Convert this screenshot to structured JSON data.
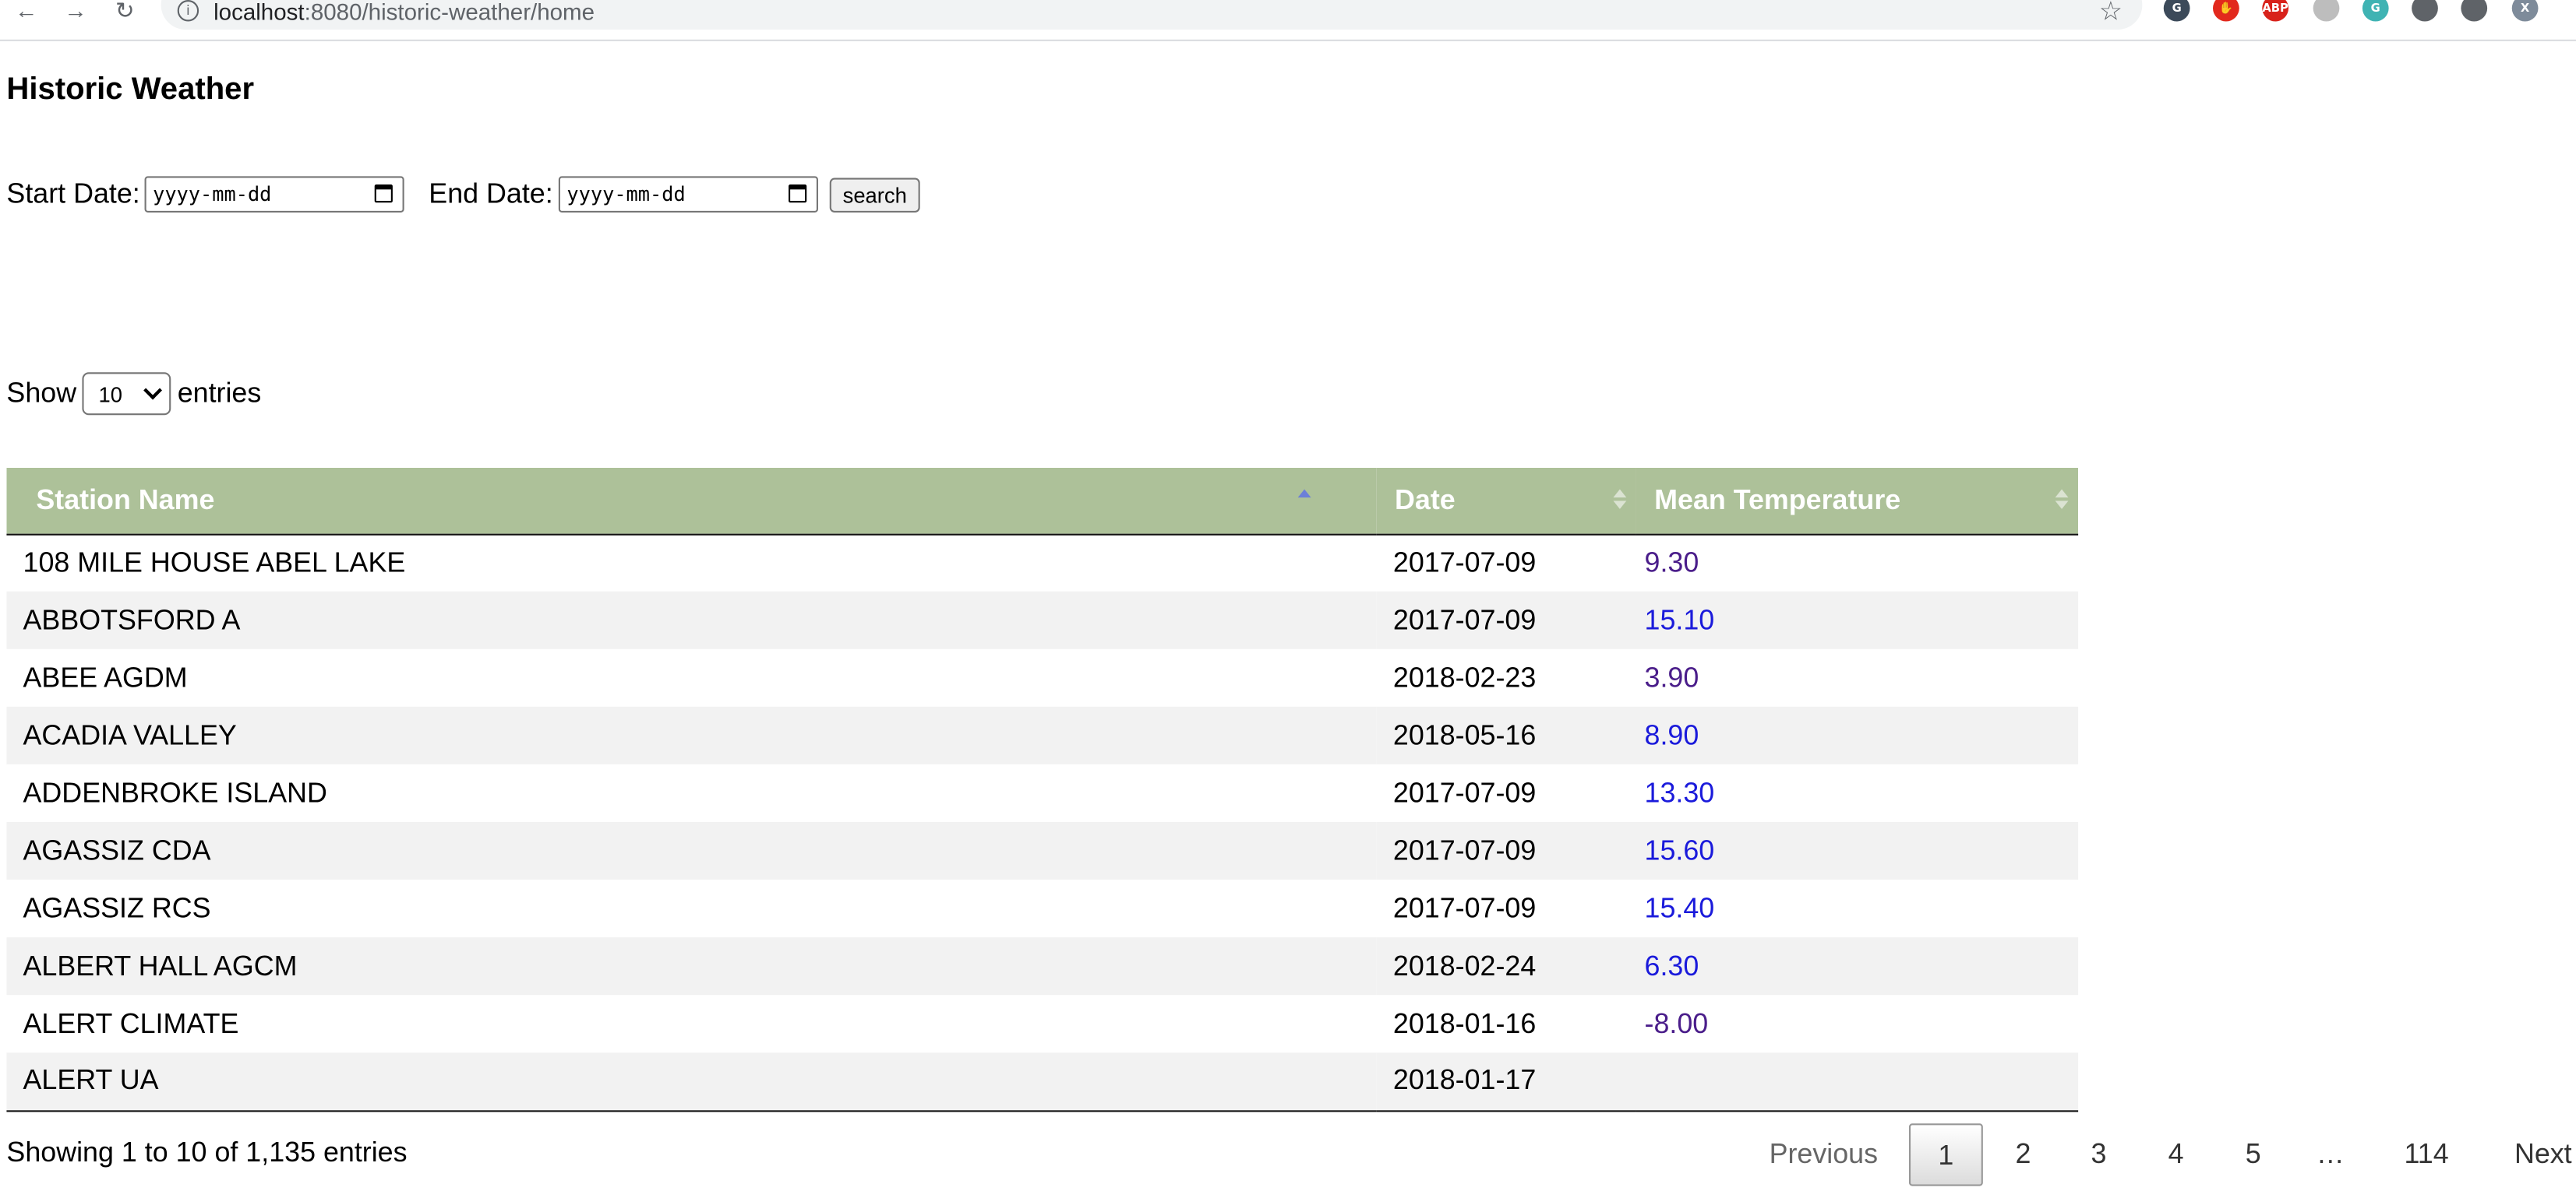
{
  "browser": {
    "url_host": "localhost",
    "url_path": ":8080/historic-weather/home",
    "extensions": [
      {
        "icon": "google-g-icon",
        "glyph": "G",
        "color": "#3c4a5a"
      },
      {
        "icon": "adblock-hand-icon",
        "glyph": "✋",
        "color": "#e2291d"
      },
      {
        "icon": "abp-icon",
        "glyph": "ABP",
        "color": "#d8221b"
      },
      {
        "icon": "circle-extension-icon",
        "glyph": "",
        "color": "#bdbdbd"
      },
      {
        "icon": "leaf-extension-icon",
        "glyph": "G",
        "color": "#3fb3b3"
      },
      {
        "icon": "puzzle-icon",
        "glyph": "",
        "color": "#5f6368"
      },
      {
        "icon": "media-queue-icon",
        "glyph": "",
        "color": "#5f6368"
      },
      {
        "icon": "profile-avatar",
        "glyph": "X",
        "color": "#7e8b9a"
      }
    ]
  },
  "page": {
    "title": "Historic Weather",
    "start_label": "Start Date:",
    "end_label": "End Date:",
    "date_placeholder": "yyyy-mm-dd",
    "search_label": "search",
    "show_label": "Show",
    "entries_label": "entries",
    "length_value": "10"
  },
  "table": {
    "columns": [
      "Station Name",
      "Date",
      "Mean Temperature"
    ],
    "sorted_column": "Station Name",
    "rows": [
      {
        "station": "108 MILE HOUSE ABEL LAKE",
        "date": "2017-07-09",
        "temp": "9.30",
        "temp_color": "#4a1d8a"
      },
      {
        "station": "ABBOTSFORD A",
        "date": "2017-07-09",
        "temp": "15.10",
        "temp_color": "#1a1adb"
      },
      {
        "station": "ABEE AGDM",
        "date": "2018-02-23",
        "temp": "3.90",
        "temp_color": "#4a1d8a"
      },
      {
        "station": "ACADIA VALLEY",
        "date": "2018-05-16",
        "temp": "8.90",
        "temp_color": "#1a1adb"
      },
      {
        "station": "ADDENBROKE ISLAND",
        "date": "2017-07-09",
        "temp": "13.30",
        "temp_color": "#1a1adb"
      },
      {
        "station": "AGASSIZ CDA",
        "date": "2017-07-09",
        "temp": "15.60",
        "temp_color": "#1a1adb"
      },
      {
        "station": "AGASSIZ RCS",
        "date": "2017-07-09",
        "temp": "15.40",
        "temp_color": "#1a1adb"
      },
      {
        "station": "ALBERT HALL AGCM",
        "date": "2018-02-24",
        "temp": "6.30",
        "temp_color": "#1a1adb"
      },
      {
        "station": "ALERT CLIMATE",
        "date": "2018-01-16",
        "temp": "-8.00",
        "temp_color": "#4a1d8a"
      },
      {
        "station": "ALERT UA",
        "date": "2018-01-17",
        "temp": "",
        "temp_color": "#1a1adb"
      }
    ]
  },
  "footer": {
    "info": "Showing 1 to 10 of 1,135 entries",
    "previous": "Previous",
    "pages": [
      "1",
      "2",
      "3",
      "4",
      "5",
      "…",
      "114"
    ],
    "current_page": "1",
    "next": "Next"
  }
}
